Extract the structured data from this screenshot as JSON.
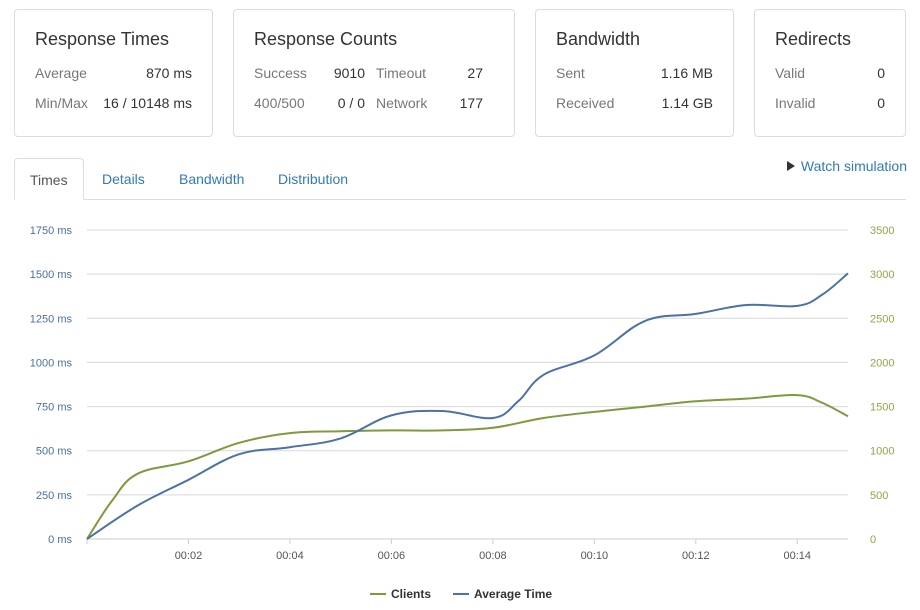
{
  "cards": {
    "response_times": {
      "title": "Response Times",
      "average_label": "Average",
      "average_value": "870 ms",
      "minmax_label": "Min/Max",
      "minmax_value": "16 / 10148 ms"
    },
    "response_counts": {
      "title": "Response Counts",
      "success_label": "Success",
      "success_value": "9010",
      "timeout_label": "Timeout",
      "timeout_value": "27",
      "errors_label": "400/500",
      "errors_value": "0 / 0",
      "network_label": "Network",
      "network_value": "177"
    },
    "bandwidth": {
      "title": "Bandwidth",
      "sent_label": "Sent",
      "sent_value": "1.16 MB",
      "received_label": "Received",
      "received_value": "1.14 GB"
    },
    "redirects": {
      "title": "Redirects",
      "valid_label": "Valid",
      "valid_value": "0",
      "invalid_label": "Invalid",
      "invalid_value": "0"
    }
  },
  "tabs": [
    {
      "label": "Times",
      "active": true
    },
    {
      "label": "Details",
      "active": false
    },
    {
      "label": "Bandwidth",
      "active": false
    },
    {
      "label": "Distribution",
      "active": false
    }
  ],
  "watch_simulation": {
    "label": "Watch simulation",
    "icon": "play-icon"
  },
  "colors": {
    "clients": "#7d9a3c",
    "average_time": "#4a72a8",
    "grid": "#d8d8d8",
    "left_axis_text": "#4a6fa5",
    "right_axis_text": "#8aa84a"
  },
  "chart_data": {
    "type": "line",
    "x_ticks": [
      "00:02",
      "00:04",
      "00:06",
      "00:08",
      "00:10",
      "00:12",
      "00:14"
    ],
    "x_tick_minutes": [
      2,
      4,
      6,
      8,
      10,
      12,
      14
    ],
    "xlim": [
      0,
      15
    ],
    "y_left": {
      "ticks": [
        "0 ms",
        "250 ms",
        "500 ms",
        "750 ms",
        "1000 ms",
        "1250 ms",
        "1500 ms",
        "1750 ms"
      ],
      "ylim": [
        0,
        1750
      ]
    },
    "y_right": {
      "ticks": [
        "0",
        "500",
        "1000",
        "1500",
        "2000",
        "2500",
        "3000",
        "3500"
      ],
      "ylim": [
        0,
        3500
      ]
    },
    "grid": true,
    "legend_position": "bottom-center",
    "series": [
      {
        "name": "Clients",
        "axis": "right",
        "x": [
          0,
          0.5,
          1,
          2,
          3,
          4,
          5,
          6,
          7,
          8,
          9,
          10,
          11,
          12,
          13,
          14,
          14.5,
          15
        ],
        "y": [
          0,
          440,
          740,
          880,
          1090,
          1200,
          1220,
          1230,
          1230,
          1260,
          1370,
          1440,
          1500,
          1560,
          1590,
          1630,
          1540,
          1390
        ]
      },
      {
        "name": "Average Time",
        "axis": "left",
        "x": [
          0,
          1,
          2,
          3,
          4,
          5,
          6,
          7,
          8,
          8.5,
          9,
          10,
          11,
          12,
          13,
          14,
          14.5,
          15
        ],
        "y": [
          0,
          190,
          335,
          480,
          520,
          570,
          700,
          725,
          685,
          780,
          930,
          1040,
          1235,
          1275,
          1325,
          1320,
          1385,
          1505
        ]
      }
    ]
  }
}
